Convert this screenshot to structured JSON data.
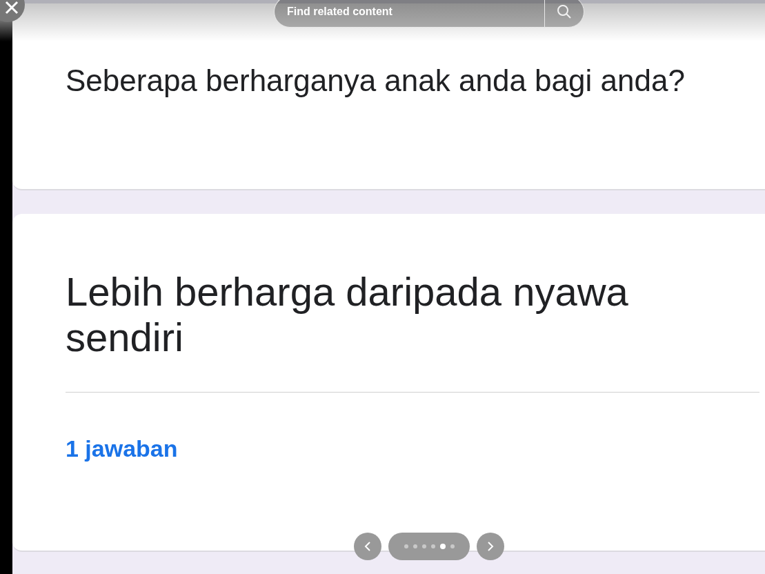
{
  "search": {
    "placeholder": "Find related content"
  },
  "question": {
    "title": "Seberapa berharganya anak anda bagi anda?"
  },
  "answer": {
    "text": "Lebih berharga daripada nyawa sendiri",
    "count": "1 jawaban"
  },
  "pager": {
    "dots": [
      {
        "selected": false
      },
      {
        "selected": false
      },
      {
        "selected": false
      },
      {
        "selected": false
      },
      {
        "selected": true
      },
      {
        "selected": false
      }
    ]
  }
}
